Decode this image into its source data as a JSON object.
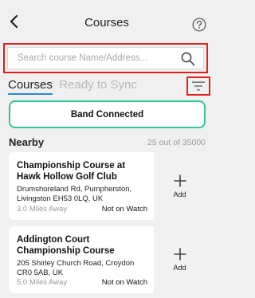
{
  "header": {
    "title": "Courses"
  },
  "search": {
    "placeholder": "Search course Name/Address..."
  },
  "tabs": [
    {
      "label": "Courses"
    },
    {
      "label": "Ready to Sync"
    }
  ],
  "band_button": {
    "label": "Band Connected"
  },
  "nearby": {
    "label": "Nearby",
    "count": "25 out of 35000"
  },
  "courses": [
    {
      "name": "Championship Course at Hawk Hollow Golf Club",
      "address": "Drumshoreland Rd, Pumpherston, Livingston EH53 0LQ, UK",
      "distance": "3.0 Miles Away",
      "watch_status": "Not on Watch",
      "add_label": "Add"
    },
    {
      "name": "Addington Court Championship Course",
      "address": "205 Shirley Church Road, Croydon CR0 5AB, UK",
      "distance": "5.0 Miles Away",
      "watch_status": "Not on Watch",
      "add_label": "Add"
    }
  ],
  "colors": {
    "accent": "#2a8ad2",
    "band_border": "#39c09a",
    "highlight": "#e02020"
  },
  "icons": [
    "back-arrow-icon",
    "help-icon",
    "search-icon",
    "filter-icon",
    "plus-icon"
  ]
}
